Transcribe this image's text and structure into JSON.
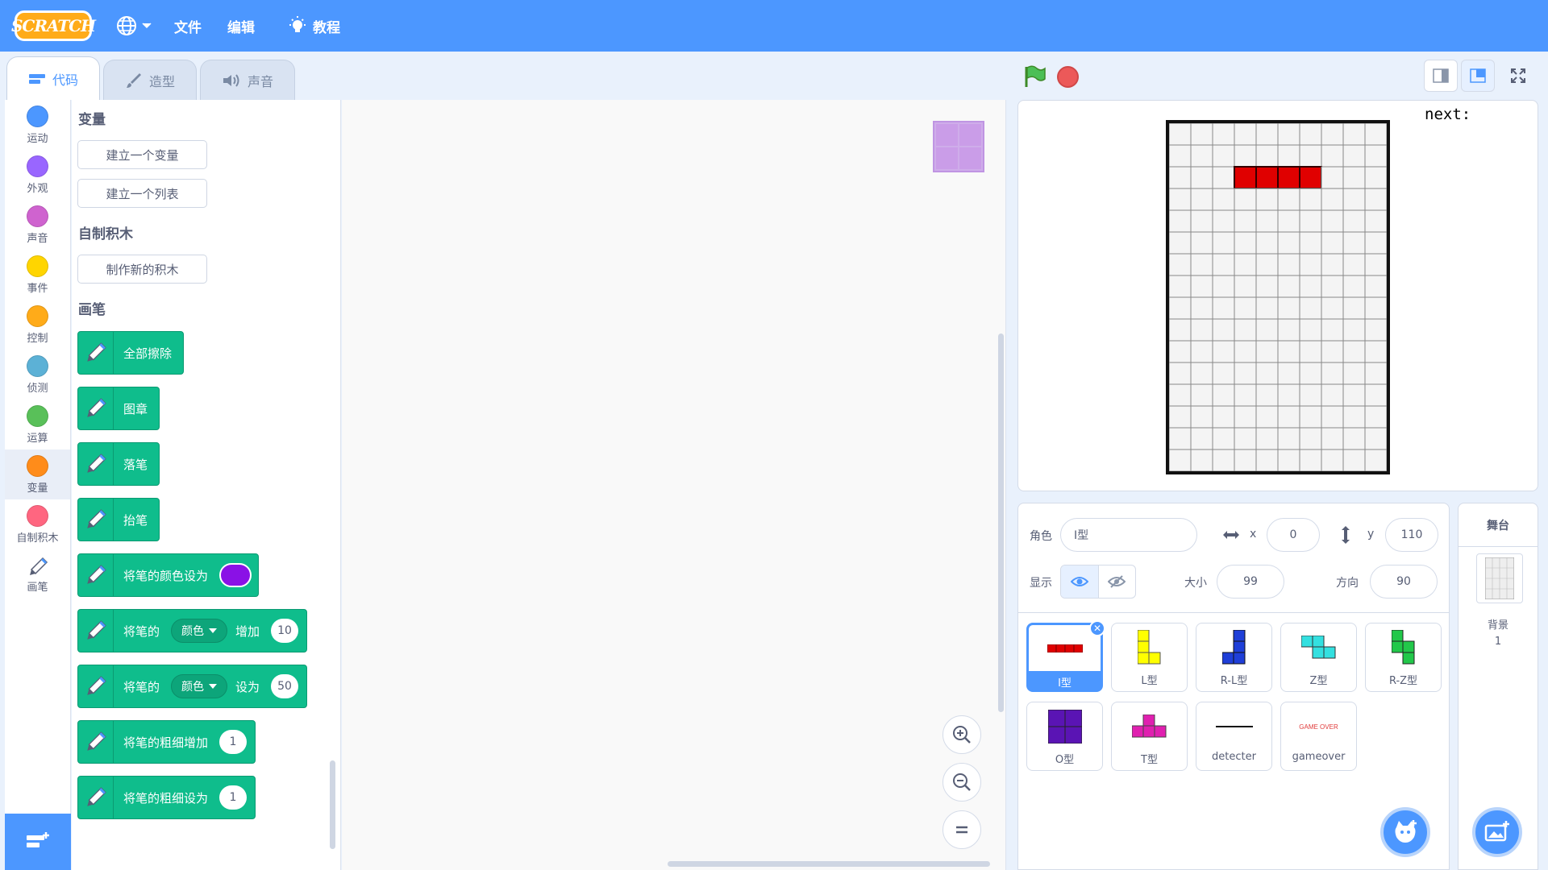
{
  "menubar": {
    "logo": "SCRATCH",
    "file": "文件",
    "edit": "编辑",
    "tutorials": "教程"
  },
  "tabs": {
    "code": "代码",
    "costumes": "造型",
    "sounds": "声音"
  },
  "categories": [
    {
      "label": "运动",
      "color": "#4c97ff"
    },
    {
      "label": "外观",
      "color": "#9966ff"
    },
    {
      "label": "声音",
      "color": "#cf63cf"
    },
    {
      "label": "事件",
      "color": "#ffd500"
    },
    {
      "label": "控制",
      "color": "#ffab19"
    },
    {
      "label": "侦测",
      "color": "#5cb1d6"
    },
    {
      "label": "运算",
      "color": "#59c059"
    },
    {
      "label": "变量",
      "color": "#ff8c1a"
    },
    {
      "label": "自制积木",
      "color": "#ff6680"
    },
    {
      "label": "画笔",
      "color": "#0fbd8c"
    }
  ],
  "palette": {
    "variables_title": "变量",
    "make_variable": "建立一个变量",
    "make_list": "建立一个列表",
    "my_blocks_title": "自制积木",
    "make_block": "制作新的积木",
    "pen_title": "画笔",
    "blocks": {
      "erase_all": "全部擦除",
      "stamp": "图章",
      "pen_down": "落笔",
      "pen_up": "抬笔",
      "set_color_to": "将笔的颜色设为",
      "pen_color_swatch": "#8a11e6",
      "change_param_a": "将笔的",
      "change_param_dd": "颜色",
      "change_param_b": "增加",
      "change_param_val": "10",
      "set_param_a": "将笔的",
      "set_param_dd": "颜色",
      "set_param_b": "设为",
      "set_param_val": "50",
      "change_size": "将笔的粗细增加",
      "change_size_val": "1",
      "set_size": "将笔的粗细设为",
      "set_size_val": "1"
    }
  },
  "stage": {
    "next_label": "next:",
    "board": {
      "cols": 10,
      "rows": 16,
      "filled_row": 2,
      "filled_cols": [
        3,
        4,
        5,
        6
      ],
      "fill_color": "#e00000"
    }
  },
  "sprite_info": {
    "sprite_label": "角色",
    "sprite_name": "I型",
    "x_label": "x",
    "x_value": "0",
    "y_label": "y",
    "y_value": "110",
    "show_label": "显示",
    "size_label": "大小",
    "size_value": "99",
    "direction_label": "方向",
    "direction_value": "90"
  },
  "sprites": [
    {
      "name": "I型",
      "selected": true
    },
    {
      "name": "L型"
    },
    {
      "name": "R-L型"
    },
    {
      "name": "Z型"
    },
    {
      "name": "R-Z型"
    },
    {
      "name": "O型"
    },
    {
      "name": "T型"
    },
    {
      "name": "detecter"
    },
    {
      "name": "gameover",
      "art_text": "GAME OVER"
    }
  ],
  "stage_pane": {
    "title": "舞台",
    "backdrop_label": "背景",
    "backdrop_count": "1"
  }
}
